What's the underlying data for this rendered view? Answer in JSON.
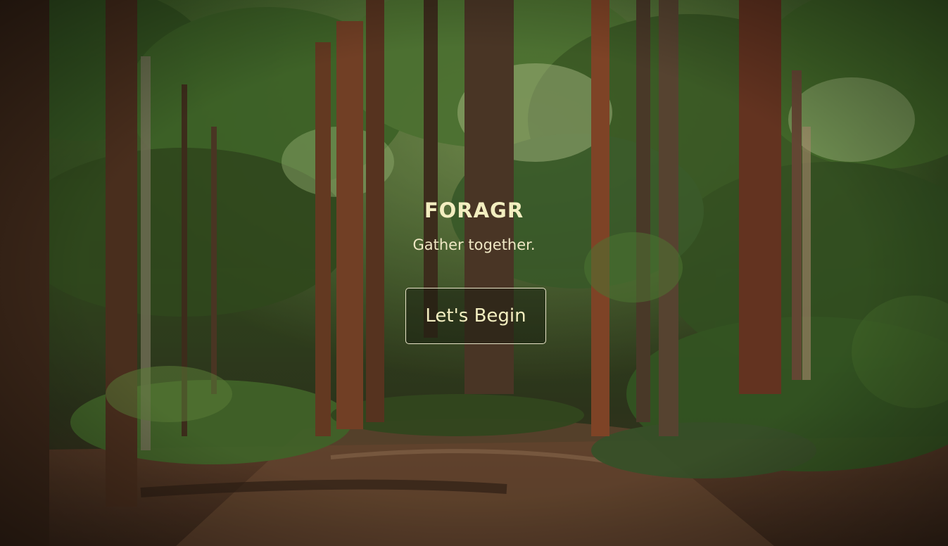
{
  "hero": {
    "title": "FORAGR",
    "tagline": "Gather together.",
    "cta_label": "Let's Begin"
  },
  "background": {
    "scene": "forest-path-photo"
  },
  "colors": {
    "text": "#f3eec0",
    "button_border": "#e9e4c8",
    "foliage": "#2f5a22",
    "trunk": "#6a3a22"
  }
}
